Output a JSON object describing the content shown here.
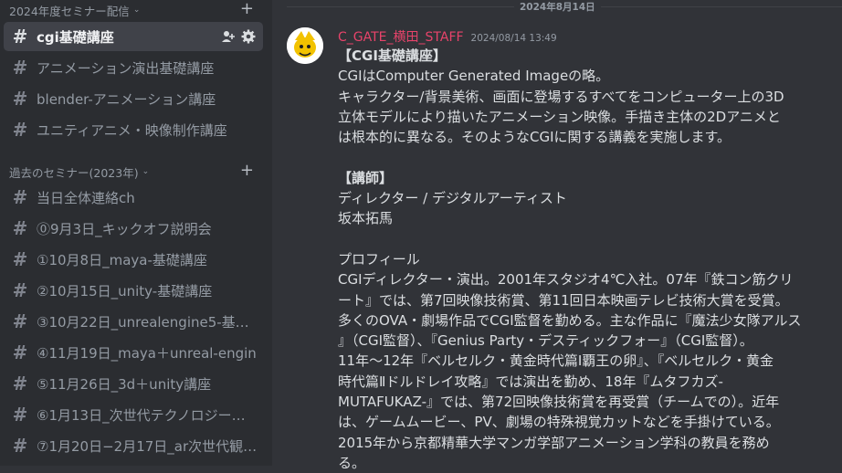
{
  "sidebar": {
    "category1": {
      "label": "2024年度セミナー配信"
    },
    "category1_channels": [
      {
        "label": "cgi基礎講座",
        "active": true
      },
      {
        "label": "アニメーション演出基礎講座"
      },
      {
        "label": "blender-アニメーション講座"
      },
      {
        "label": "ユニティアニメ・映像制作講座"
      }
    ],
    "category2": {
      "label": "過去のセミナー(2023年)"
    },
    "category2_channels": [
      {
        "label": "当日全体連絡ch"
      },
      {
        "label": "⓪9月3日_キックオフ説明会"
      },
      {
        "label": "①10月8日_maya-基礎講座"
      },
      {
        "label": "②10月15日_unity-基礎講座"
      },
      {
        "label": "③10月22日_unrealengine5-基…"
      },
      {
        "label": "④11月19日_maya＋unreal-engin…"
      },
      {
        "label": "⑤11月26日_3d＋unity講座"
      },
      {
        "label": "⑥1月13日_次世代テクノロジー…"
      },
      {
        "label": "⑦1月20日−2月17日_ar次世代観…"
      }
    ]
  },
  "main": {
    "date_divider": "2024年8月14日",
    "message": {
      "author": "C_GATE_横田_STAFF",
      "timestamp": "2024/08/14 13:49",
      "lines": [
        {
          "text": "【CGI基礎講座】",
          "bold": true
        },
        {
          "text": "CGIはComputer Generated Imageの略。"
        },
        {
          "text": "キャラクター/背景美術、画面に登場するすべてをコンピューター上の3D"
        },
        {
          "text": "立体モデルにより描いたアニメーション映像。手描き主体の2Dアニメと"
        },
        {
          "text": "は根本的に異なる。そのようなCGIに関する講義を実施します。"
        },
        {
          "text": ""
        },
        {
          "text": "【講師】",
          "bold": true
        },
        {
          "text": "ディレクター / デジタルアーティスト"
        },
        {
          "text": "坂本拓馬"
        },
        {
          "text": ""
        },
        {
          "text": "プロフィール"
        },
        {
          "text": "CGIディレクター・演出。2001年スタジオ4℃入社。07年『鉄コン筋クリ"
        },
        {
          "text": "ート』では、第7回映像技術賞、第11回日本映画テレビ技術大賞を受賞。"
        },
        {
          "text": "多くのOVA・劇場作品でCGI監督を勤める。主な作品に『魔法少女隊アルス"
        },
        {
          "text": "』（CGI監督）、『Genius Party・デスティックフォー』（CGI監督）。"
        },
        {
          "text": "11年～12年『ベルセルク・黄金時代篇Ⅰ覇王の卵』、『ベルセルク・黄金"
        },
        {
          "text": "時代篇Ⅱドルドレイ攻略』では演出を勤め、18年『ムタフカズ-"
        },
        {
          "text": "MUTAFUKAZ-』では、第72回映像技術賞を再受賞（チームでの）。近年"
        },
        {
          "text": "は、ゲームムービー、PV、劇場の特殊視覚カットなどを手掛けている。"
        },
        {
          "text": "2015年から京都精華大学マンガ学部アニメーション学科の教員を務め"
        },
        {
          "text": "る。"
        }
      ]
    }
  },
  "colors": {
    "sidebar_bg": "#2b2d31",
    "main_bg": "#313338",
    "author": "#e7436a",
    "active_channel_bg": "#404249"
  }
}
